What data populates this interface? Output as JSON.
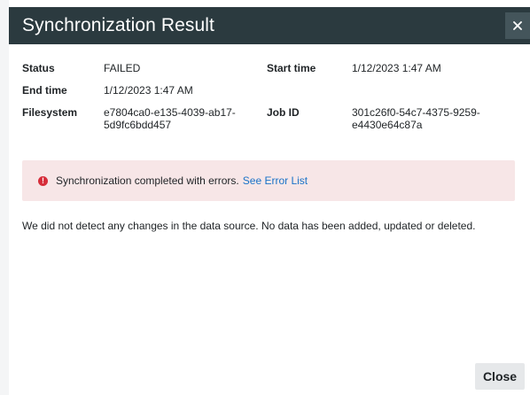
{
  "dialog": {
    "title": "Synchronization Result",
    "close_label": "Close"
  },
  "details": {
    "status_label": "Status",
    "status_value": "FAILED",
    "start_time_label": "Start time",
    "start_time_value": "1/12/2023 1:47 AM",
    "end_time_label": "End time",
    "end_time_value": "1/12/2023 1:47 AM",
    "filesystem_label": "Filesystem",
    "filesystem_value_line1": "e7804ca0-e135-4039-ab17-",
    "filesystem_value_line2": "5d9fc6bdd457",
    "job_id_label": "Job ID",
    "job_id_value_line1": "301c26f0-54c7-4375-9259-",
    "job_id_value_line2": "e4430e64c87a"
  },
  "alert": {
    "icon": "error-icon",
    "icon_glyph": "!",
    "message": "Synchronization completed with errors.",
    "link_text": "See Error List",
    "background_color": "#f7e6e7",
    "icon_color": "#d62d3a"
  },
  "summary_text": "We did not detect any changes in the data source. No data has been added, updated or deleted.",
  "colors": {
    "header_bg": "#2b3a3f",
    "link": "#1a73c8"
  }
}
